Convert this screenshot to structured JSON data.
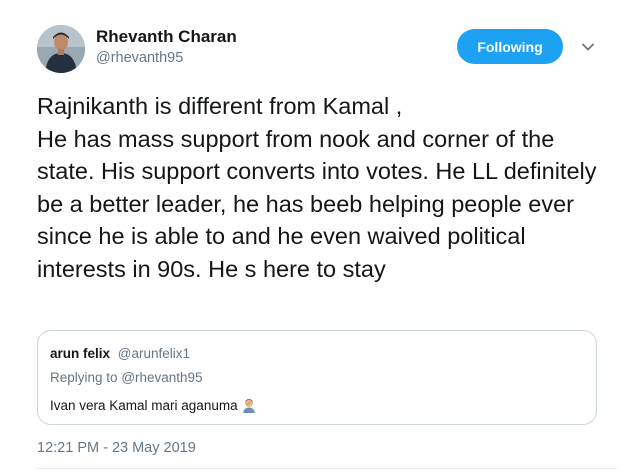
{
  "tweet": {
    "author": {
      "name": "Rhevanth Charan",
      "handle": "@rhevanth95"
    },
    "follow_button": "Following",
    "text": "Rajnikanth is different from Kamal ,\nHe has mass support from nook and corner of the state. His support converts into votes. He LL definitely be a better leader, he has beeb helping people ever since he is able to and he even waived political interests in 90s. He s here to stay",
    "timestamp": "12:21 PM - 23 May 2019"
  },
  "quoted_tweet": {
    "name": "arun felix",
    "handle": "@arunfelix1",
    "replying_prefix": "Replying to",
    "replying_to": "@rhevanth95",
    "text": "Ivan vera Kamal mari aganuma",
    "emoji": "man-facepalming-emoji"
  },
  "colors": {
    "accent": "#1da1f2",
    "secondary_text": "#657786",
    "border": "#ccd6dd"
  },
  "icons": {
    "caret": "chevron-down-icon"
  }
}
